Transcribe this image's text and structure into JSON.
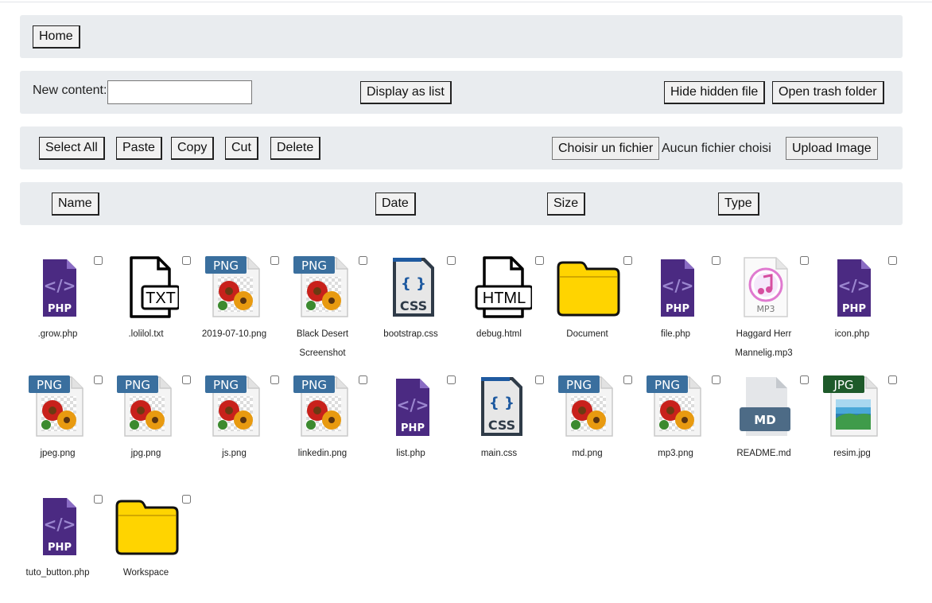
{
  "nav": {
    "home_label": "Home"
  },
  "toolbar": {
    "new_content_label": "New content:",
    "new_content_value": "",
    "display_list_label": "Display as list",
    "hide_hidden_label": "Hide hidden file",
    "open_trash_label": "Open trash folder"
  },
  "actions": {
    "select_all_label": "Select All",
    "paste_label": "Paste",
    "copy_label": "Copy",
    "cut_label": "Cut",
    "delete_label": "Delete",
    "choose_file_label": "Choisir un fichier",
    "no_file_label": "Aucun fichier choisi",
    "upload_label": "Upload Image"
  },
  "columns": {
    "name": "Name",
    "date": "Date",
    "size": "Size",
    "type": "Type"
  },
  "files": [
    {
      "name": ".grow.php",
      "icon": "php"
    },
    {
      "name": ".lolilol.txt",
      "icon": "txt"
    },
    {
      "name": "2019-07-10.png",
      "icon": "png"
    },
    {
      "name": "Black Desert Screenshot",
      "icon": "png"
    },
    {
      "name": "bootstrap.css",
      "icon": "css"
    },
    {
      "name": "debug.html",
      "icon": "html"
    },
    {
      "name": "Document",
      "icon": "folder"
    },
    {
      "name": "file.php",
      "icon": "php"
    },
    {
      "name": "Haggard Herr Mannelig.mp3",
      "icon": "mp3"
    },
    {
      "name": "icon.php",
      "icon": "php"
    },
    {
      "name": "jpeg.png",
      "icon": "png"
    },
    {
      "name": "jpg.png",
      "icon": "png"
    },
    {
      "name": "js.png",
      "icon": "png"
    },
    {
      "name": "linkedin.png",
      "icon": "png"
    },
    {
      "name": "list.php",
      "icon": "php"
    },
    {
      "name": "main.css",
      "icon": "css"
    },
    {
      "name": "md.png",
      "icon": "png"
    },
    {
      "name": "mp3.png",
      "icon": "png"
    },
    {
      "name": "README.md",
      "icon": "md"
    },
    {
      "name": "resim.jpg",
      "icon": "jpg"
    },
    {
      "name": "tuto_button.php",
      "icon": "php"
    },
    {
      "name": "Workspace",
      "icon": "folder"
    }
  ],
  "icon_labels": {
    "php": "PHP",
    "txt": "TXT",
    "png": "PNG",
    "css": "CSS",
    "html": "HTML",
    "mp3": "MP3",
    "md": "MD",
    "jpg": "JPG",
    "braces": "{ }"
  },
  "colors": {
    "php": "#4b2a82",
    "png_badge": "#3a6f9e",
    "jpg_badge": "#1e5a2a",
    "folder": "#ffd400",
    "md_badge": "#4d6b86",
    "bar": "#e9ecef"
  }
}
